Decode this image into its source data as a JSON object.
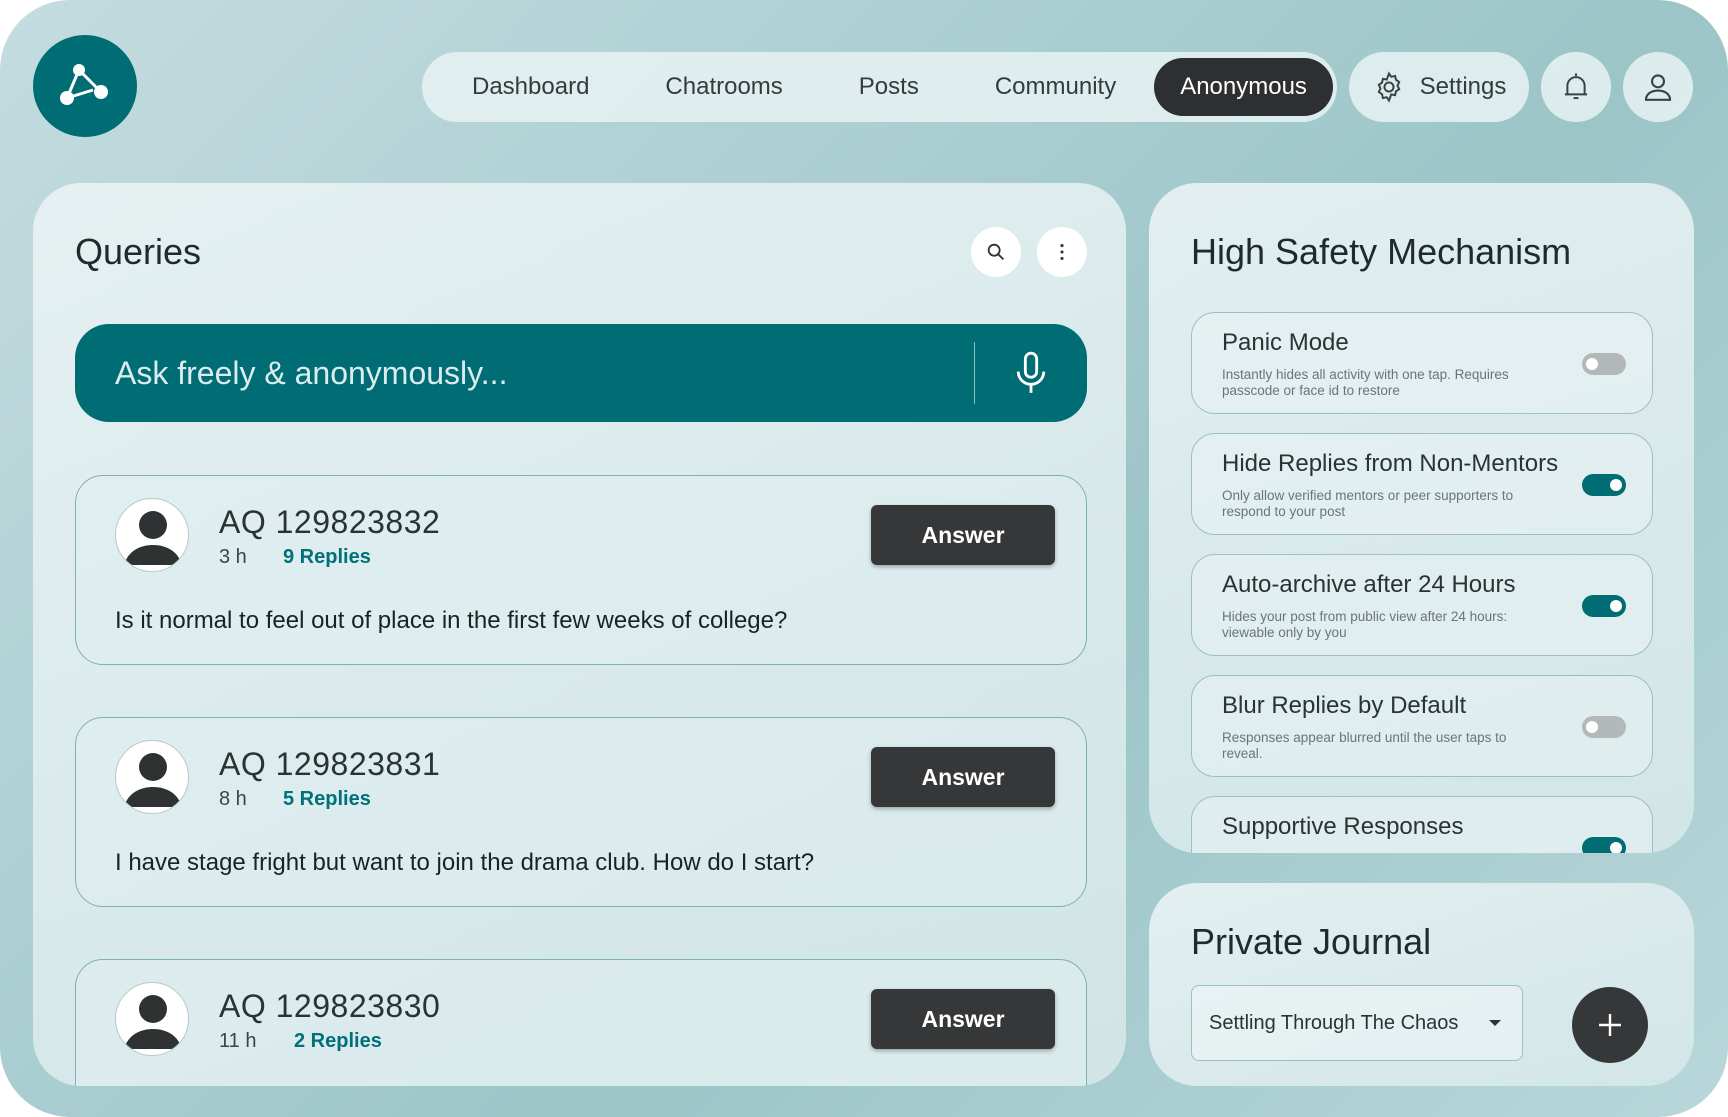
{
  "nav": {
    "items": [
      "Dashboard",
      "Chatrooms",
      "Posts",
      "Community"
    ],
    "active": "Anonymous"
  },
  "settings": {
    "label": "Settings"
  },
  "queries": {
    "title": "Queries",
    "ask_placeholder": "Ask freely & anonymously...",
    "answer_label": "Answer",
    "items": [
      {
        "id": "AQ 129823832",
        "time": "3 h",
        "replies": "9 Replies",
        "text": "Is it normal to feel out of place in the first few weeks of college?"
      },
      {
        "id": "AQ 129823831",
        "time": "8 h",
        "replies": "5 Replies",
        "text": "I have stage fright but want to join the drama club. How do I start?"
      },
      {
        "id": "AQ 129823830",
        "time": "11 h",
        "replies": "2 Replies",
        "text": ""
      }
    ]
  },
  "safety": {
    "title": "High Safety Mechanism",
    "items": [
      {
        "title": "Panic Mode",
        "desc": "Instantly hides all activity with one tap. Requires passcode or face id to restore",
        "on": false
      },
      {
        "title": "Hide Replies from Non-Mentors",
        "desc": "Only allow verified mentors or peer supporters to respond to your post",
        "on": true
      },
      {
        "title": "Auto-archive after 24 Hours",
        "desc": "Hides your post from public view after 24 hours: viewable only by you",
        "on": true
      },
      {
        "title": "Blur Replies by Default",
        "desc": "Responses appear blurred until the user taps to reveal.",
        "on": false
      },
      {
        "title": "Supportive Responses",
        "desc": "",
        "on": true
      }
    ]
  },
  "journal": {
    "title": "Private Journal",
    "selected": "Settling Through The Chaos"
  },
  "colors": {
    "primary": "#006d75",
    "dark": "#353738",
    "accent_text": "#00707a"
  }
}
